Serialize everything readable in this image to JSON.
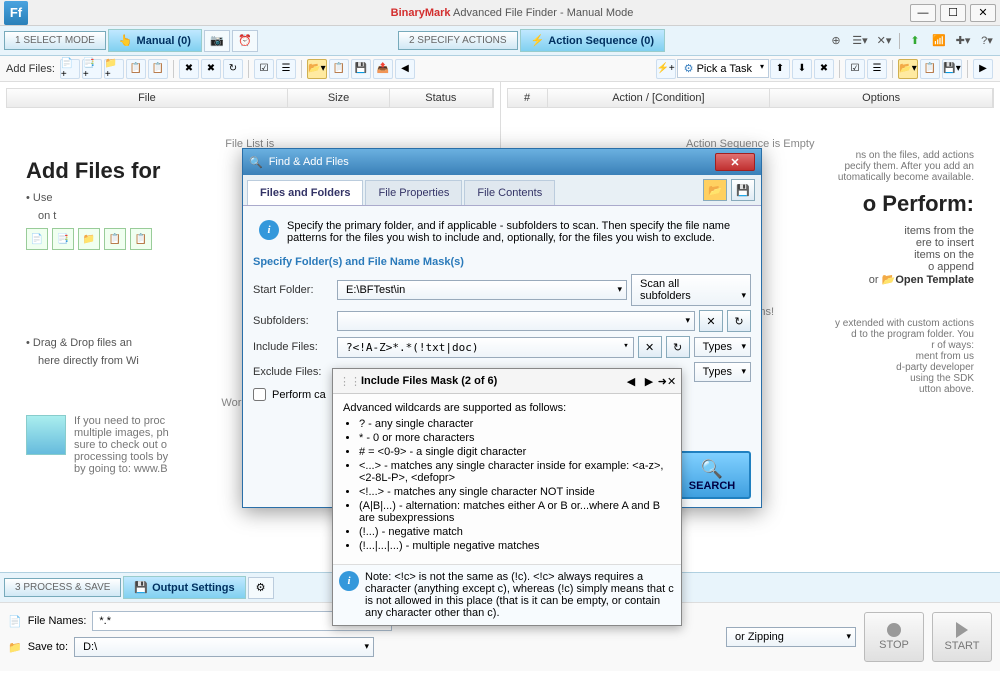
{
  "titlebar": {
    "brand": "BinaryMark",
    "title": "Advanced File Finder - Manual Mode",
    "icon_text": "Ff"
  },
  "ribbon_left": {
    "step_label": "1 SELECT MODE",
    "manual_tab": "Manual (0)"
  },
  "ribbon_right": {
    "step_label": "2 SPECIFY ACTIONS",
    "action_tab": "Action Sequence (0)"
  },
  "toolbar_left": {
    "label": "Add Files:"
  },
  "toolbar_right": {
    "pick_task": "Pick a Task"
  },
  "left_cols": [
    "File",
    "Size",
    "Status"
  ],
  "right_cols": [
    "#",
    "Action / [Condition]",
    "Options"
  ],
  "left_body": {
    "filelist_empty": "File List is",
    "h1": "Add Files for",
    "bullet1": "Use",
    "bullet2": "on t",
    "arrows": [
      "Paste path",
      "Paste files fro",
      "Recursively add file",
      "Add all files from a give",
      "Add specific files individuall"
    ],
    "drag": "Drag & Drop files an",
    "drag2": "here directly from Wi",
    "working": "Working wit",
    "note1": "If you need to proc",
    "note2": "multiple images, ph",
    "note3": "sure to check out o",
    "note4": "processing tools by",
    "note5": "by going to: www.B"
  },
  "right_body": {
    "empty": "Action Sequence is Empty",
    "line1": "ns on the files, add actions",
    "line2": "pecify them. After you add an",
    "line3": "utomatically become available.",
    "h1": "o Perform:",
    "b1": "items from the",
    "b2": "ere to insert",
    "b3": "items on the",
    "b4": "o append",
    "b5a": "or",
    "b5b": "Open Template",
    "actions_h": "n Actions!",
    "a1": "y extended with custom actions",
    "a2": "d to the program folder. You",
    "a3": "r of ways:",
    "a4": "ment from us",
    "a5": "d-party developer",
    "a6": "using the SDK",
    "a7": "utton above."
  },
  "bottom": {
    "step3": "3 PROCESS & SAVE",
    "output_tab": "Output Settings",
    "file_names_label": "File Names:",
    "file_names_value": "*.*",
    "save_to_label": "Save to:",
    "save_to_value": "D:\\",
    "zip_dd": "or Zipping",
    "stop": "STOP",
    "start": "START"
  },
  "dialog": {
    "title": "Find & Add Files",
    "tabs": [
      "Files and Folders",
      "File Properties",
      "File Contents"
    ],
    "intro": "Specify the primary folder, and if applicable - subfolders to scan. Then specify the file name patterns for the files you wish to include and, optionally, for the files you wish to exclude.",
    "section": "Specify Folder(s) and File Name Mask(s)",
    "start_folder_label": "Start Folder:",
    "start_folder_value": "E:\\BFTest\\in",
    "scan_dd": "Scan all subfolders",
    "subfolders_label": "Subfolders:",
    "include_label": "Include Files:",
    "include_value": "?<!A-Z>*.*(!txt|doc)",
    "exclude_label": "Exclude Files:",
    "types_dd": "Types",
    "case_label": "Perform ca",
    "search": "SEARCH"
  },
  "tooltip": {
    "header": "Include Files Mask (2 of 6)",
    "intro": "Advanced wildcards are supported as follows:",
    "items": [
      "? - any single character",
      "* - 0 or more characters",
      "# = <0-9> - a single digit character",
      "<...> - matches any single character inside for example: <a-z>, <2-8L-P>, <defopr>",
      "<!...> - matches any single character NOT inside",
      "(A|B|...) - alternation: matches either A or B or...where A and B are subexpressions",
      "(!...) - negative match",
      "(!...|...|...) - multiple negative matches"
    ],
    "note": "Note: <!c> is not the same as (!c). <!c> always requires a character (anything except c), whereas (!c) simply means that c is not allowed in this place (that is it can be empty, or contain any character other than c)."
  }
}
